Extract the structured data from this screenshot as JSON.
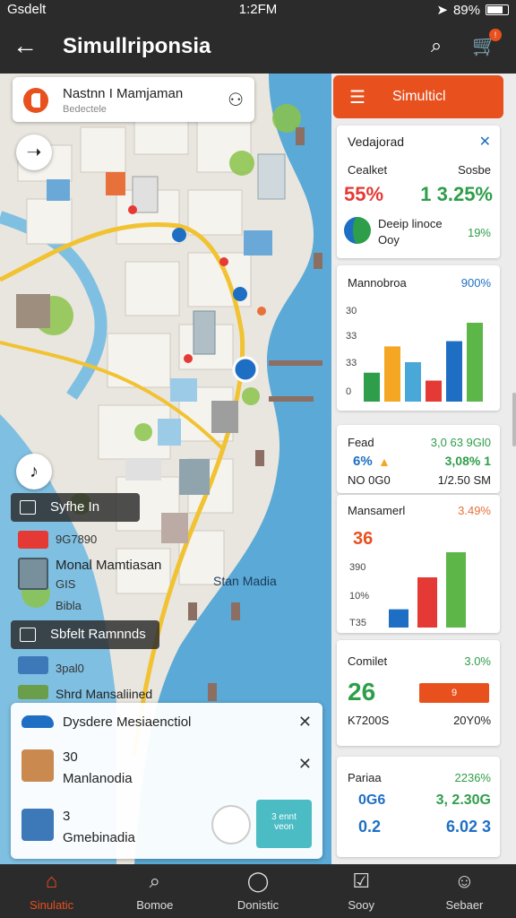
{
  "status_bar": {
    "carrier": "Gsdelt",
    "time": "1:2FM",
    "battery": "89%"
  },
  "app_bar": {
    "title": "Simullriponsia",
    "notification_count": "!"
  },
  "search_card": {
    "name": "Nastnn I Mamjaman",
    "subtitle": "Bedectele"
  },
  "map": {
    "tag1": "Syfhe In",
    "row1_value": "9G7890",
    "row2_title": "Monal Mamtiasan",
    "row2_sub1": "GIS",
    "row2_sub2": "Bibla",
    "tag2": "Sbfelt Ramnnds",
    "row3_value": "3pal0",
    "row3_title": "Shrd Mansaliined",
    "water_label": "Stan Madia"
  },
  "place_list": {
    "row1": "Dysdere Mesiaenctiol",
    "row2_value": "30",
    "row2_label": "Manlanodia",
    "row3_value": "3",
    "row3_label": "Gmebinadia",
    "cta_line1": "3 ennt",
    "cta_line2": "veon"
  },
  "panel": {
    "title": "Simulticl",
    "card1": {
      "title": "Vedajorad",
      "left_label": "Cealket",
      "right_label": "Sosbe",
      "left_value": "55%",
      "right_value": "1 3.25%",
      "row_line1": "Deeip linoce",
      "row_line2": "Ooy",
      "row_value": "19%"
    },
    "card2": {
      "title": "Mannobroa",
      "value": "900%",
      "ticks": [
        "30",
        "33",
        "33",
        "0"
      ],
      "colors": [
        "#2e9e4a",
        "#f5a623",
        "#4aa8d8",
        "#e53935",
        "#1e6fc4",
        "#5cb648"
      ],
      "values": [
        11,
        21,
        15,
        8,
        23,
        30
      ]
    },
    "card3": {
      "left_label": "Fead",
      "right_label": "3,0 63 9Gl0",
      "left_value": "6%",
      "right_value": "3,08% 1",
      "left_sub": "NO 0G0",
      "right_sub": "1/2.50 SM"
    },
    "card4": {
      "title": "Mansamerl",
      "value": "3.49%",
      "big_value": "36",
      "ticks": [
        "390",
        "10%",
        "T35"
      ],
      "colors": [
        "#1e6fc4",
        "#e53935",
        "#5cb648"
      ],
      "values": [
        8,
        22,
        33
      ]
    },
    "card5": {
      "title": "Comilet",
      "value": "3.0%",
      "big_value": "26",
      "bar_label": "9",
      "left_sub": "K7200S",
      "right_sub": "20Y0%"
    },
    "card6": {
      "title": "Pariaa",
      "value": "2236%",
      "left_value1": "0G6",
      "right_value1": "3, 2.30G",
      "left_value2": "0.2",
      "right_value2": "6.02 3"
    }
  },
  "bottom_nav": [
    {
      "label": "Sinulatic",
      "icon": "home-icon"
    },
    {
      "label": "Bomoe",
      "icon": "search-icon"
    },
    {
      "label": "Donistic",
      "icon": "chat-icon"
    },
    {
      "label": "Sooy",
      "icon": "clipboard-icon"
    },
    {
      "label": "Sebaer",
      "icon": "profile-icon"
    }
  ]
}
